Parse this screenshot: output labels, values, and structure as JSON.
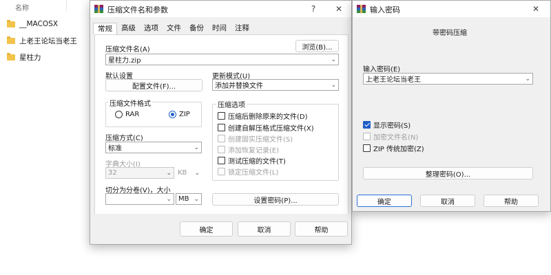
{
  "explorer": {
    "column_name": "名称",
    "items": [
      {
        "name": "__MACOSX",
        "icon": "folder-icon"
      },
      {
        "name": "上老王论坛当老王",
        "icon": "folder-icon"
      },
      {
        "name": "星柱力",
        "icon": "folder-icon"
      }
    ]
  },
  "archive_dialog": {
    "title": "压缩文件名和参数",
    "help_glyph": "?",
    "close_glyph": "✕",
    "tabs": [
      "常规",
      "高级",
      "选项",
      "文件",
      "备份",
      "时间",
      "注释"
    ],
    "archive_name_label": "压缩文件名(A)",
    "archive_name_value": "星柱力.zip",
    "browse_button": "浏览(B)...",
    "default_settings_label": "默认设置",
    "profiles_button": "配置文件(F)...",
    "update_mode_label": "更新模式(U)",
    "update_mode_value": "添加并替换文件",
    "format_group_title": "压缩文件格式",
    "format_rar": "RAR",
    "format_zip": "ZIP",
    "selected_format": "ZIP",
    "method_label": "压缩方式(C)",
    "method_value": "标准",
    "dict_label": "字典大小(I)",
    "dict_value": "32",
    "dict_unit": "KB",
    "split_label": "切分为分卷(V)，大小",
    "split_value": "",
    "split_unit": "MB",
    "options_group_title": "压缩选项",
    "options": [
      {
        "label": "压缩后删除原来的文件(D)",
        "checked": false,
        "enabled": true
      },
      {
        "label": "创建自解压格式压缩文件(X)",
        "checked": false,
        "enabled": true
      },
      {
        "label": "创建固实压缩文件(S)",
        "checked": false,
        "enabled": false
      },
      {
        "label": "添加恢复记录(E)",
        "checked": false,
        "enabled": false
      },
      {
        "label": "测试压缩的文件(T)",
        "checked": false,
        "enabled": true
      },
      {
        "label": "锁定压缩文件(L)",
        "checked": false,
        "enabled": false
      }
    ],
    "set_password_button": "设置密码(P)...",
    "ok_button": "确定",
    "cancel_button": "取消",
    "help_button": "帮助"
  },
  "password_dialog": {
    "title": "输入密码",
    "close_glyph": "✕",
    "subtitle": "带密码压缩",
    "enter_password_label": "输入密码(E)",
    "password_value": "上老王论坛当老王",
    "show_password_label": "显示密码(S)",
    "show_password_checked": true,
    "encrypt_names_label": "加密文件名(N)",
    "encrypt_names_checked": false,
    "zip_legacy_label": "ZIP 传统加密(Z)",
    "zip_legacy_checked": false,
    "organize_button": "整理密码(O)...",
    "ok_button": "确定",
    "cancel_button": "取消",
    "help_button": "帮助"
  },
  "colors": {
    "accent": "#1e5fc6",
    "folder": "#f3c34c",
    "dialog_bg": "#f0f0f0"
  }
}
